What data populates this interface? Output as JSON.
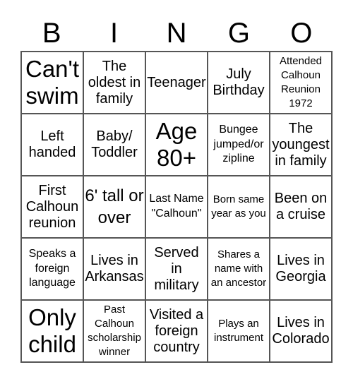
{
  "header": [
    "B",
    "I",
    "N",
    "G",
    "O"
  ],
  "cells": [
    {
      "text": "Can't swim",
      "size": "xl"
    },
    {
      "text": "The oldest in family",
      "size": "m"
    },
    {
      "text": "Teenager",
      "size": "m"
    },
    {
      "text": "July Birthday",
      "size": "m"
    },
    {
      "text": "Attended Calhoun Reunion 1972",
      "size": "xs"
    },
    {
      "text": "Left handed",
      "size": "m"
    },
    {
      "text": "Baby/ Toddler",
      "size": "m"
    },
    {
      "text": "Age 80+",
      "size": "xl"
    },
    {
      "text": "Bungee jumped/or zipline",
      "size": "s"
    },
    {
      "text": "The youngest in family",
      "size": "m"
    },
    {
      "text": "First Calhoun reunion",
      "size": "m"
    },
    {
      "text": "6' tall or over",
      "size": "l"
    },
    {
      "text": "Last Name \"Calhoun\"",
      "size": "s"
    },
    {
      "text": "Born same year as you",
      "size": "xs"
    },
    {
      "text": "Been on a cruise",
      "size": "m"
    },
    {
      "text": "Speaks a foreign language",
      "size": "s"
    },
    {
      "text": "Lives in Arkansas",
      "size": "m"
    },
    {
      "text": "Served in military",
      "size": "m"
    },
    {
      "text": "Shares a name with an ancestor",
      "size": "xs"
    },
    {
      "text": "Lives in Georgia",
      "size": "m"
    },
    {
      "text": "Only child",
      "size": "xl"
    },
    {
      "text": "Past Calhoun scholarship winner",
      "size": "xs"
    },
    {
      "text": "Visited a foreign country",
      "size": "m"
    },
    {
      "text": "Plays an instrument",
      "size": "xs"
    },
    {
      "text": "Lives in Colorado",
      "size": "m"
    }
  ]
}
